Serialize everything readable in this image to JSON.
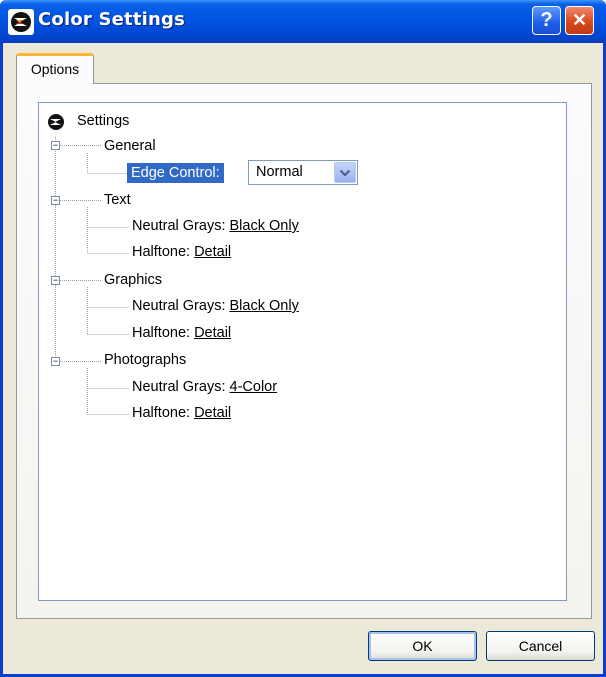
{
  "window": {
    "title": "Color Settings"
  },
  "title_buttons": {
    "help": "?",
    "close": "✕"
  },
  "tabs": [
    {
      "label": "Options"
    }
  ],
  "tree": {
    "root_label": "Settings",
    "general": {
      "label": "General",
      "edge_control_label": "Edge Control:",
      "edge_control_value": "Normal"
    },
    "text": {
      "label": "Text",
      "neutral_grays_label": "Neutral Grays:",
      "neutral_grays_value": "Black Only",
      "halftone_label": "Halftone:",
      "halftone_value": "Detail"
    },
    "graphics": {
      "label": "Graphics",
      "neutral_grays_label": "Neutral Grays:",
      "neutral_grays_value": "Black Only",
      "halftone_label": "Halftone:",
      "halftone_value": "Detail"
    },
    "photographs": {
      "label": "Photographs",
      "neutral_grays_label": "Neutral Grays:",
      "neutral_grays_value": "4-Color",
      "halftone_label": "Halftone:",
      "halftone_value": "Detail"
    }
  },
  "buttons": {
    "ok": "OK",
    "cancel": "Cancel"
  },
  "colors": {
    "titlebar": "#0054e3",
    "selection": "#316ac5",
    "tab_accent": "#f9b63a",
    "dialog_bg": "#ece9d8"
  },
  "icons": {
    "app": "hp-logo-icon",
    "expander": "minus-icon",
    "dropdown": "chevron-down-icon"
  }
}
